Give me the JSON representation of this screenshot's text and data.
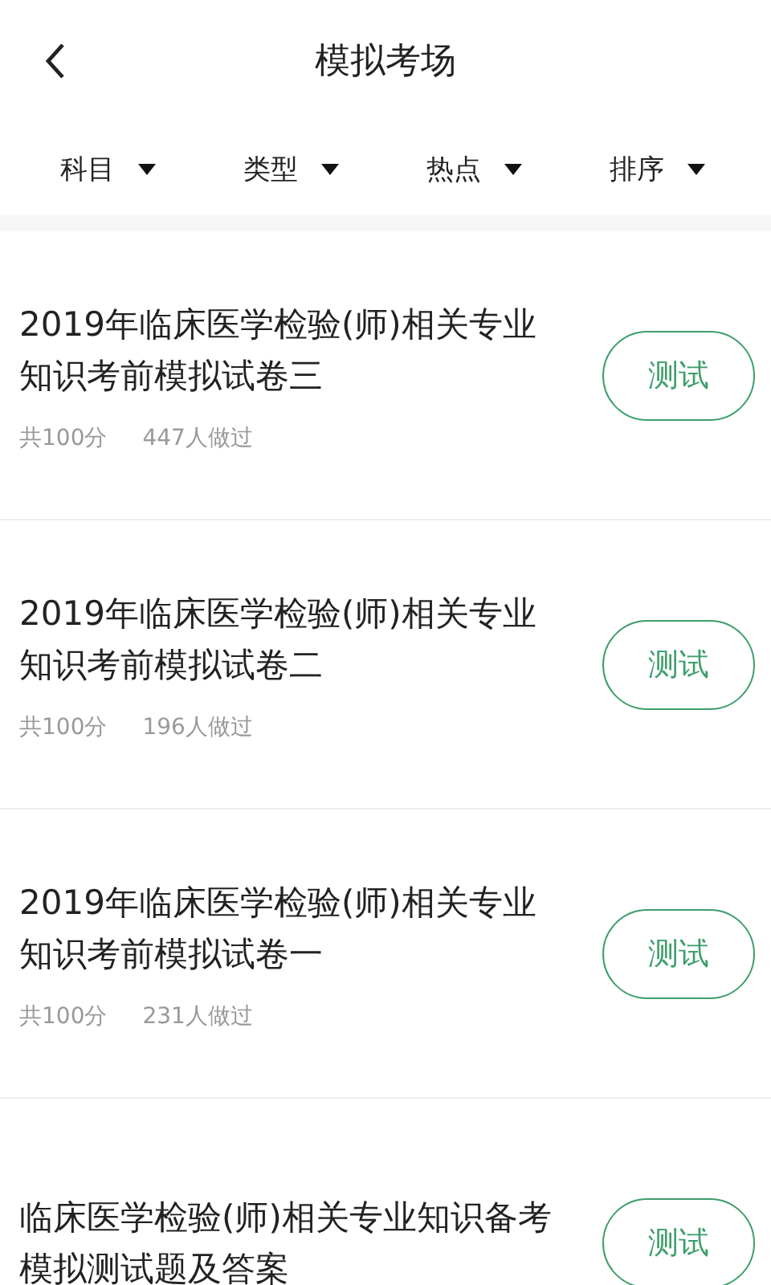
{
  "header": {
    "title": "模拟考场"
  },
  "filters": [
    {
      "label": "科目"
    },
    {
      "label": "类型"
    },
    {
      "label": "热点"
    },
    {
      "label": "排序"
    }
  ],
  "exams": [
    {
      "title": "2019年临床医学检验(师)相关专业知识考前模拟试卷三",
      "score": "共100分",
      "takers": "447人做过",
      "button": "测试"
    },
    {
      "title": "2019年临床医学检验(师)相关专业知识考前模拟试卷二",
      "score": "共100分",
      "takers": "196人做过",
      "button": "测试"
    },
    {
      "title": "2019年临床医学检验(师)相关专业知识考前模拟试卷一",
      "score": "共100分",
      "takers": "231人做过",
      "button": "测试"
    },
    {
      "title": "临床医学检验(师)相关专业知识备考模拟测试题及答案",
      "button": "测试"
    }
  ]
}
